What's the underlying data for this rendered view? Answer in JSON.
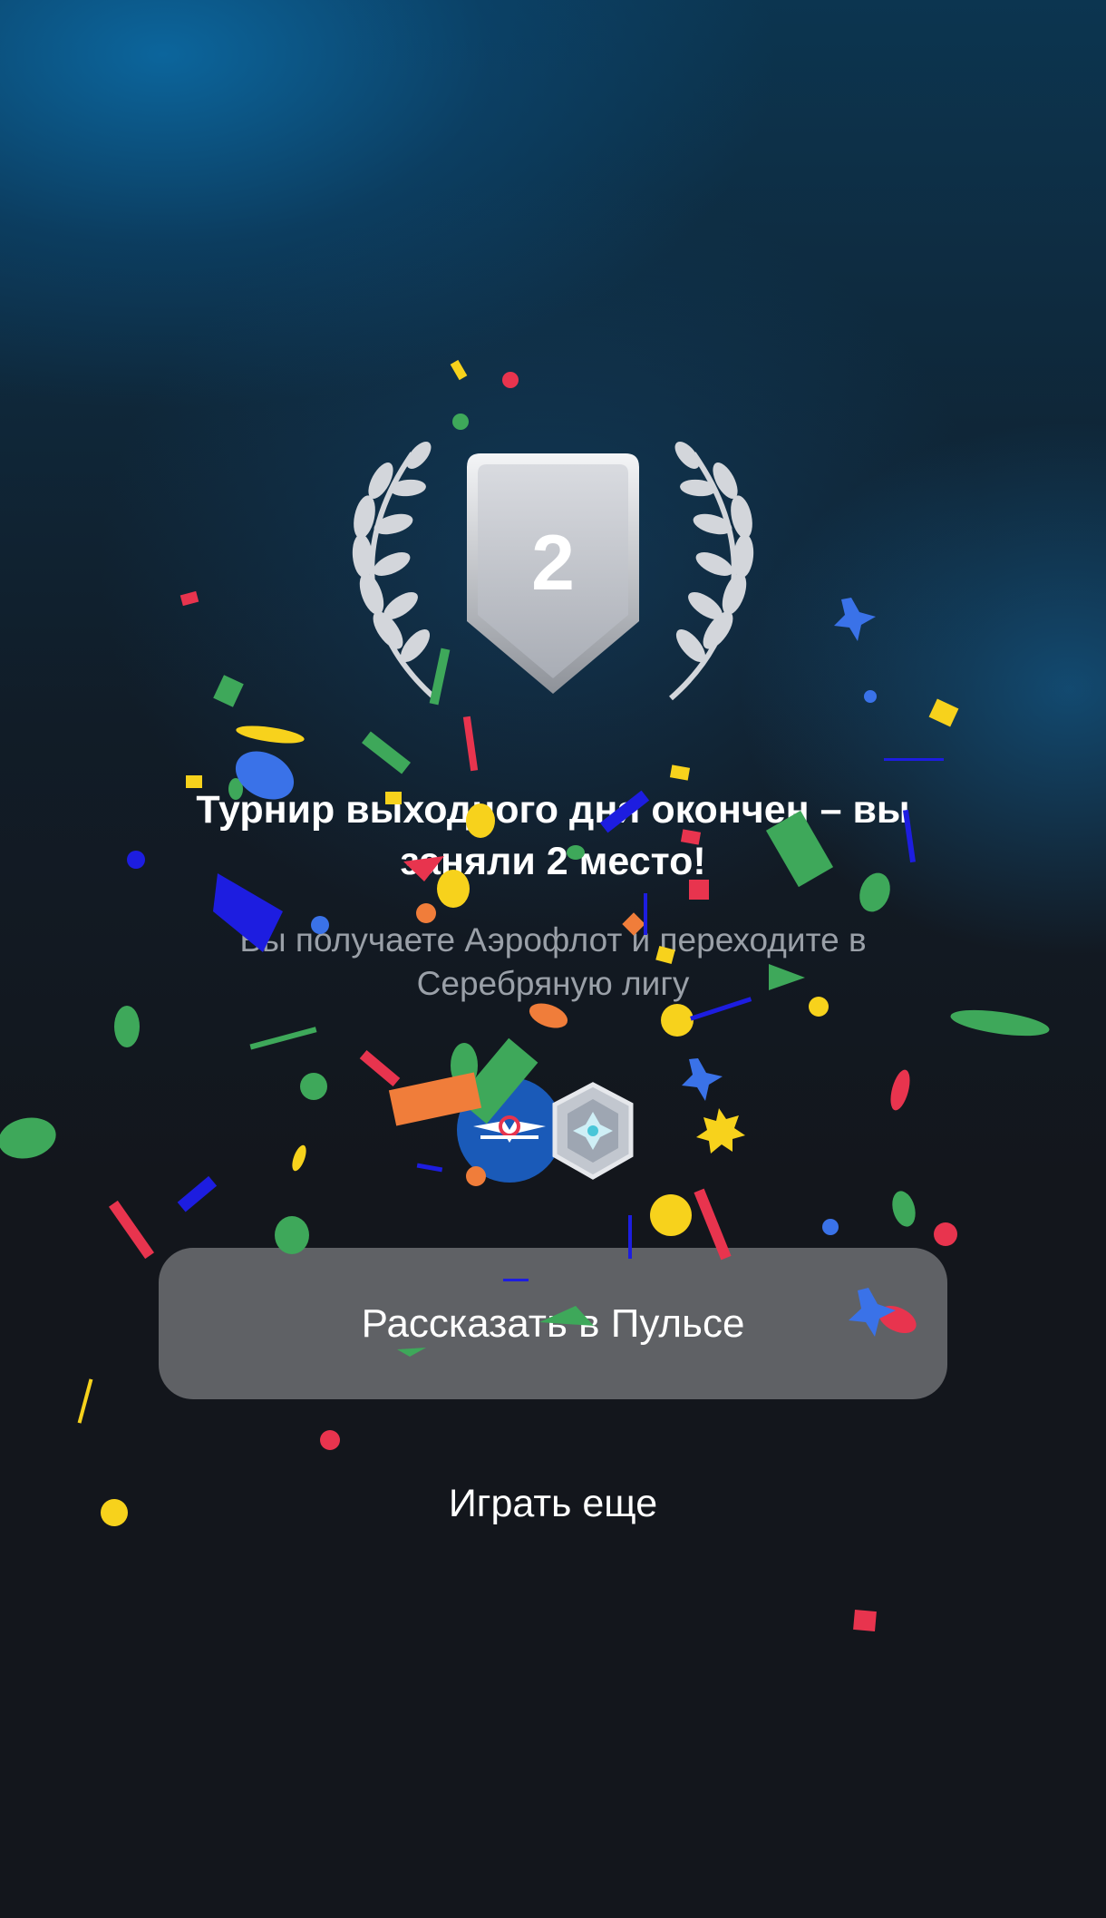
{
  "result": {
    "place_number": "2",
    "headline": "Турнир выходного дня окончен – вы заняли 2 место!",
    "subline": "Вы получаете Аэрофлот и переходите в Серебряную лигу"
  },
  "rewards": [
    {
      "icon": "aeroflot-logo-icon"
    },
    {
      "icon": "silver-league-badge-icon"
    }
  ],
  "actions": {
    "share_label": "Рассказать в Пульсе",
    "play_again_label": "Играть еще"
  },
  "colors": {
    "background": "#13161c",
    "glow": "#0c6eaa",
    "button": "#5f6165",
    "subtitle": "#9aa0a8",
    "medal_silver": "#c9ccd2",
    "confetti": [
      "#e8344e",
      "#f7d21c",
      "#3ea85a",
      "#1d1de0",
      "#3a72e8",
      "#f07d3a"
    ]
  }
}
